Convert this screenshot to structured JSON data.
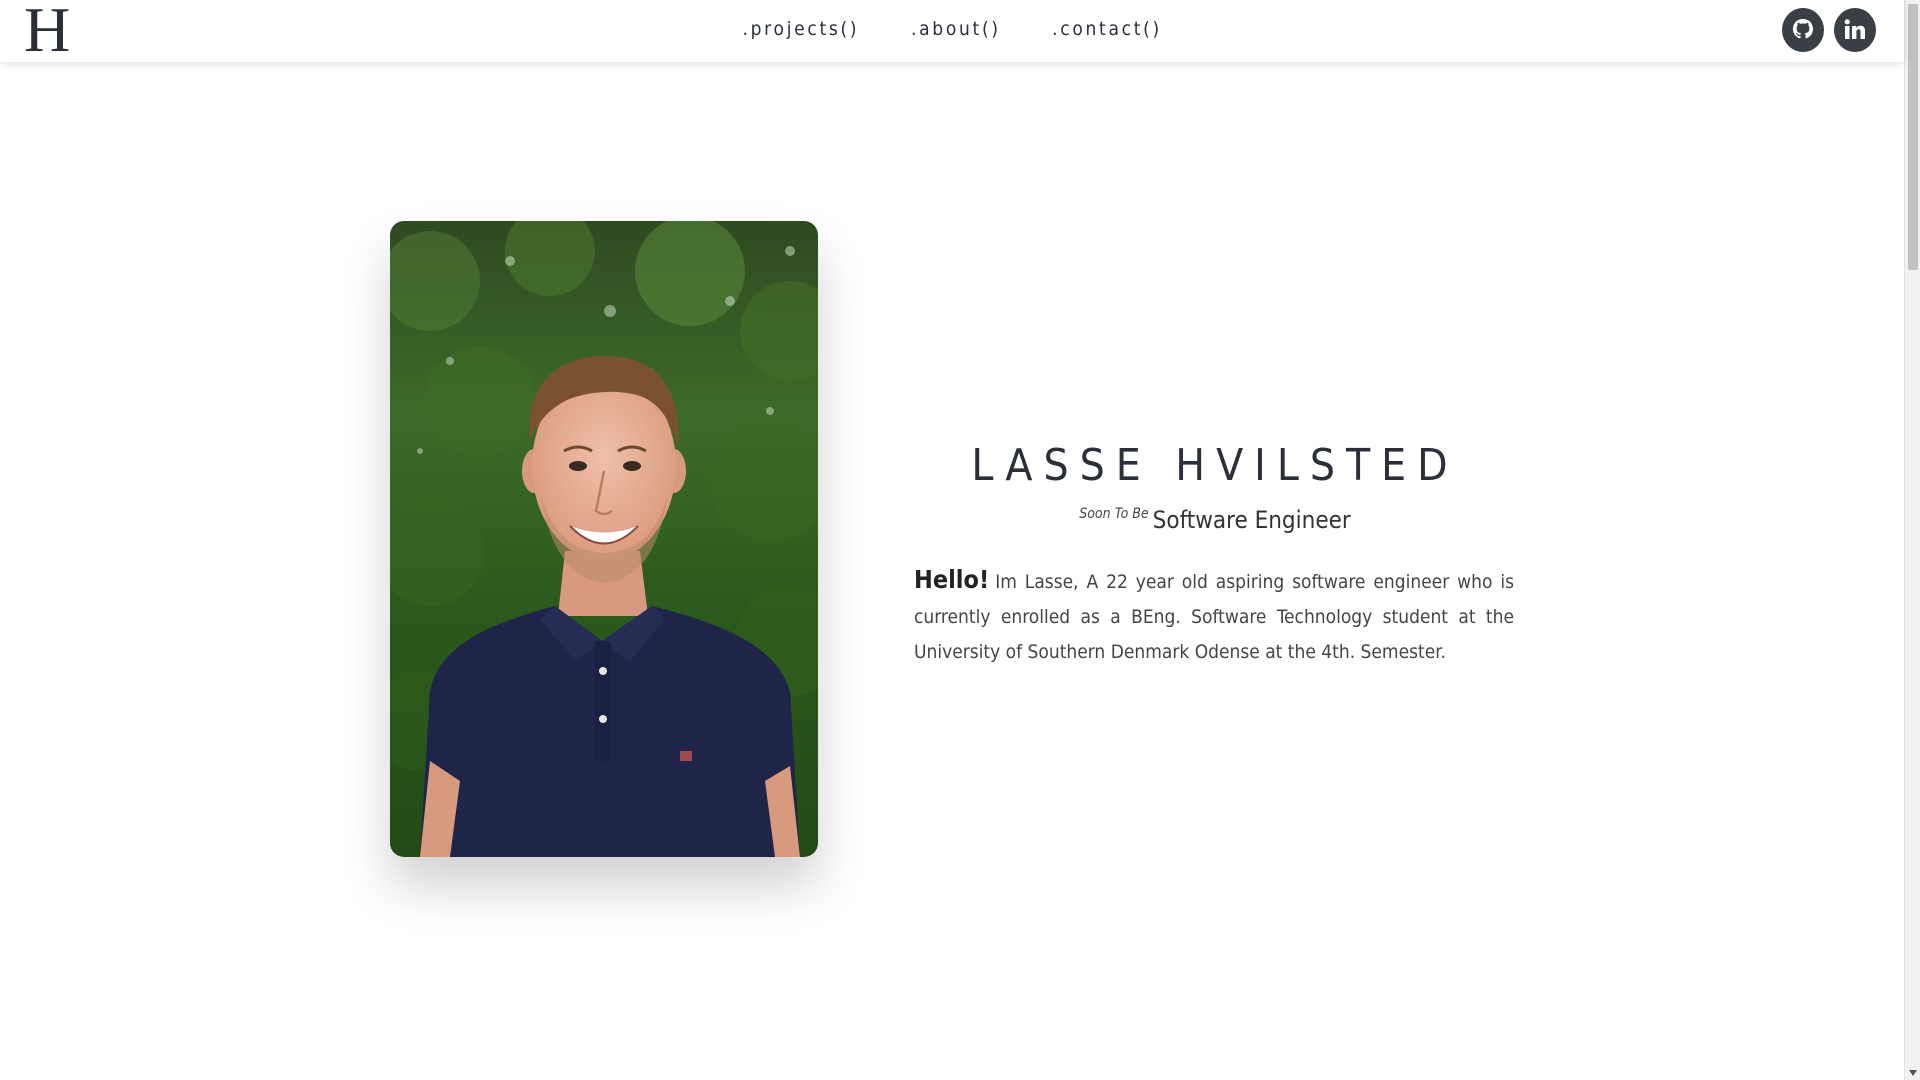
{
  "logo": {
    "text": "H"
  },
  "nav": {
    "items": [
      {
        "label": ".projects()"
      },
      {
        "label": ".about()"
      },
      {
        "label": ".contact()"
      }
    ]
  },
  "social": {
    "github": "github-icon",
    "linkedin": "linkedin-icon"
  },
  "hero": {
    "name": "LASSE HVILSTED",
    "subtitle_prefix": "Soon To Be",
    "subtitle_role": "Software Engineer",
    "greeting": "Hello!",
    "bio": "Im Lasse, A 22 year old aspiring software engineer who is currently enrolled as a BEng. Software Technology student at the University of Southern Denmark Odense at the 4th. Semester."
  },
  "colors": {
    "text_dark": "#2a2f38",
    "icon_bg": "#3a3e45",
    "shirt": "#1f2548",
    "foliage": "#2f5e1f"
  }
}
